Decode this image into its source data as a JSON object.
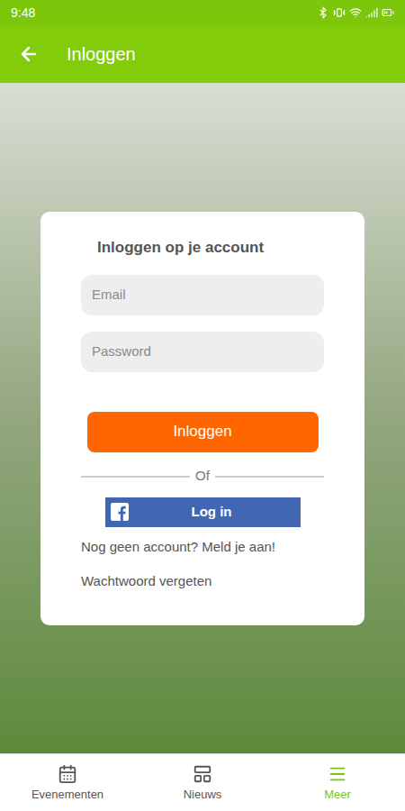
{
  "status_bar": {
    "time": "9:48"
  },
  "app_bar": {
    "title": "Inloggen"
  },
  "login_card": {
    "title": "Inloggen op je account",
    "fields": [
      {
        "placeholder": "Email",
        "kind": "email"
      },
      {
        "placeholder": "Password",
        "kind": "password"
      }
    ],
    "submit": "Inloggen",
    "divider": "Of",
    "facebook_button": "Log in",
    "signup_link": "Nog geen account? Meld je aan!",
    "forgot_link": "Wachtwoord vergeten"
  },
  "bottom_nav": [
    {
      "label": "Evenementen",
      "selected": false
    },
    {
      "label": "Nieuws",
      "selected": false
    },
    {
      "label": "Meer",
      "selected": true
    }
  ]
}
